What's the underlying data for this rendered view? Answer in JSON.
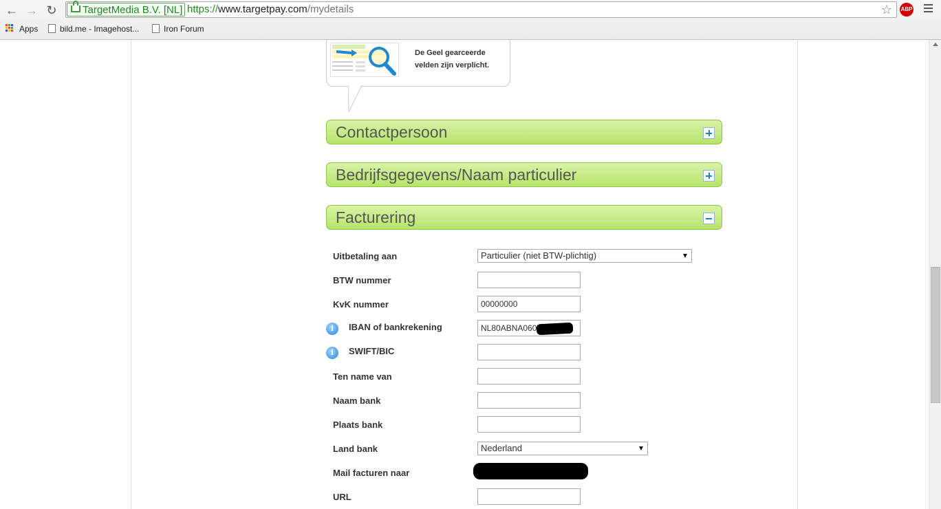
{
  "browser": {
    "ev_label": "TargetMedia B.V. [NL]",
    "url_scheme": "https://",
    "url_host": "www.targetpay.com",
    "url_path": "/mydetails",
    "abp_label": "ABP",
    "bookmarks": [
      {
        "label": "Apps"
      },
      {
        "label": "bild.me - Imagehost..."
      },
      {
        "label": "Iron Forum"
      }
    ]
  },
  "hint": {
    "line1": "De Geel gearceerde",
    "line2": "velden zijn verplicht."
  },
  "panels": [
    {
      "title": "Contactpersoon",
      "state": "collapsed"
    },
    {
      "title": "Bedrijfsgegevens/Naam particulier",
      "state": "collapsed"
    },
    {
      "title": "Facturering",
      "state": "expanded"
    }
  ],
  "form": {
    "uitbetaling_label": "Uitbetaling aan",
    "uitbetaling_value": "Particulier (niet BTW-plichtig)",
    "btw_label": "BTW nummer",
    "btw_value": "",
    "kvk_label": "KvK nummer",
    "kvk_value": "00000000",
    "iban_label": "IBAN of bankrekening",
    "iban_value": "NL80ABNA0607",
    "swift_label": "SWIFT/BIC",
    "swift_value": "",
    "tennamevan_label": "Ten name van",
    "tennamevan_value": "",
    "naambank_label": "Naam bank",
    "naambank_value": "",
    "plaatsbank_label": "Plaats bank",
    "plaatsbank_value": "",
    "landbank_label": "Land bank",
    "landbank_value": "Nederland",
    "mail_label": "Mail facturen naar",
    "url_label": "URL",
    "url_value": "",
    "info_glyph": "i"
  },
  "colors": {
    "panel_border": "#8dc63f",
    "toggle_icon": "#1e83c4",
    "ev_green": "#1f8a1f"
  }
}
